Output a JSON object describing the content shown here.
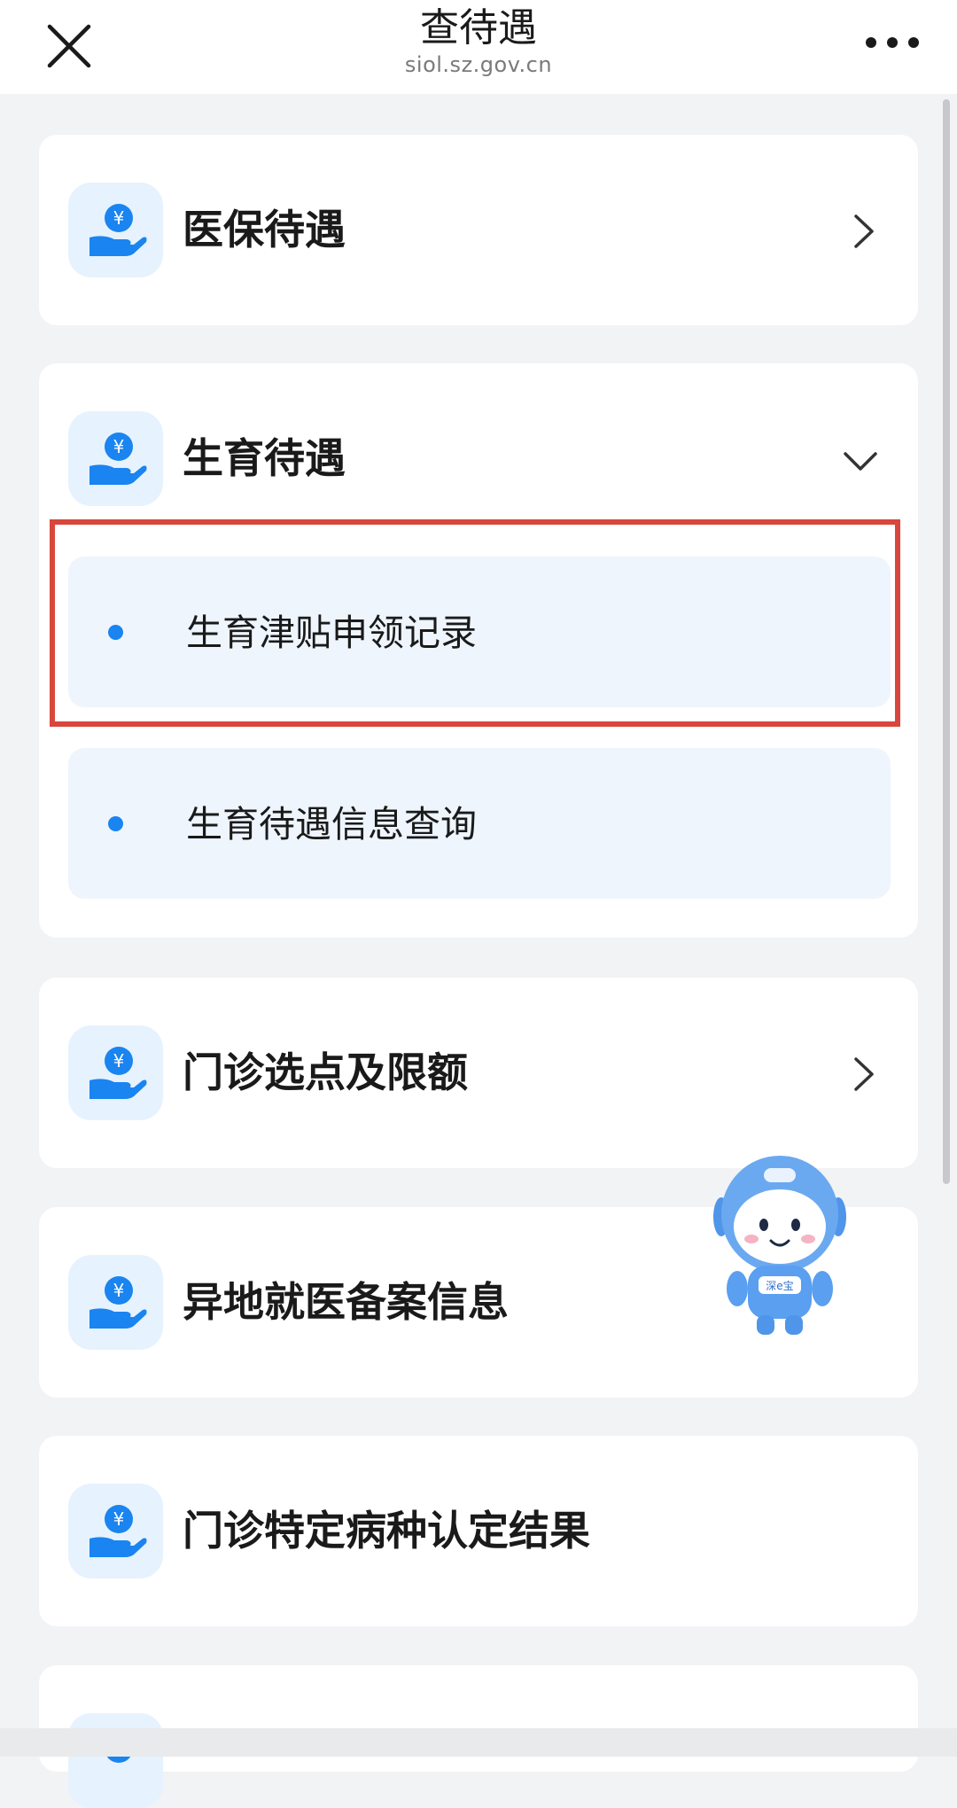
{
  "nav": {
    "title": "查待遇",
    "subtitle": "siol.sz.gov.cn",
    "close_icon": "close-icon",
    "more_icon": "more-icon"
  },
  "colors": {
    "accent": "#1a84f0",
    "icon_bg": "#e6f2fd",
    "sub_item_bg": "#eef5fd",
    "highlight": "#d9463c",
    "page_bg": "#f2f3f5"
  },
  "cards": [
    {
      "label": "医保待遇",
      "icon": "hand-yuan-icon",
      "indicator": "chevron-right-icon"
    },
    {
      "label": "生育待遇",
      "icon": "hand-yuan-icon",
      "indicator": "chevron-down-icon",
      "expanded": true,
      "sub_items": [
        {
          "label": "生育津贴申领记录",
          "highlighted": true
        },
        {
          "label": "生育待遇信息查询"
        }
      ]
    },
    {
      "label": "门诊选点及限额",
      "icon": "hand-yuan-icon",
      "indicator": "chevron-right-icon"
    },
    {
      "label": "异地就医备案信息",
      "icon": "hand-yuan-icon"
    },
    {
      "label": "门诊特定病种认定结果",
      "icon": "hand-yuan-icon"
    }
  ],
  "mascot": {
    "icon": "mascot-robot-icon",
    "badge_text": "深e宝"
  }
}
